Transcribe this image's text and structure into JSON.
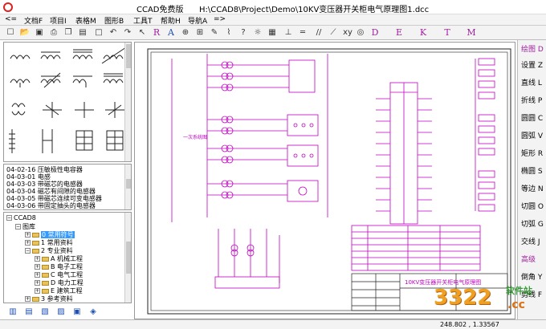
{
  "window": {
    "app_name": "CCAD免费版",
    "document_path": "H:\\CCAD8\\Project\\Demo\\10KV变压器开关柜电气原理图1.dcc"
  },
  "menu": {
    "items": [
      {
        "label": "<="
      },
      {
        "label": "文档F"
      },
      {
        "label": "项目I"
      },
      {
        "label": "表格M"
      },
      {
        "label": "图形B"
      },
      {
        "label": "工具T"
      },
      {
        "label": "帮助H"
      },
      {
        "label": "导航A"
      },
      {
        "label": "=>"
      }
    ]
  },
  "toolbar": {
    "letters": [
      {
        "label": "R"
      },
      {
        "label": "A"
      },
      {
        "label": "D"
      },
      {
        "label": "E"
      },
      {
        "label": "K"
      },
      {
        "label": "T"
      },
      {
        "label": "M"
      }
    ]
  },
  "symbol_list": {
    "items": [
      {
        "label": "04-02-16 压敏极性电容器"
      },
      {
        "label": "04-03-01 电感"
      },
      {
        "label": "04-03-03 带磁芯的电感器"
      },
      {
        "label": "04-03-04 磁芯有间隙的电感器"
      },
      {
        "label": "04-03-05 带磁芯连续可变电感器"
      },
      {
        "label": "04-03-06 带固定抽头的电感器"
      }
    ]
  },
  "tree": {
    "root": "CCAD8",
    "library": "图库",
    "items": [
      {
        "label": "0 常用符号"
      },
      {
        "label": "1 常用资料"
      },
      {
        "label": "2 专业资料"
      },
      {
        "label": "A 机械工程"
      },
      {
        "label": "B 电子工程"
      },
      {
        "label": "C 电气工程"
      },
      {
        "label": "D 电力工程"
      },
      {
        "label": "E 建筑工程"
      },
      {
        "label": "3 参考资料"
      }
    ]
  },
  "drawing": {
    "side_label": "一次系统图",
    "title_block_red": "10KV变压器开关柜电气原理图"
  },
  "right_panel": {
    "items": [
      {
        "label": "绘图 D",
        "accent": true
      },
      {
        "label": "设置 Z",
        "accent": false
      },
      {
        "label": "直线 L",
        "accent": false
      },
      {
        "label": "折线 P",
        "accent": false
      },
      {
        "label": "圆圆 C",
        "accent": false
      },
      {
        "label": "圆弧 V",
        "accent": false
      },
      {
        "label": "矩形 R",
        "accent": false
      },
      {
        "label": "椭圆 S",
        "accent": false
      },
      {
        "label": "等边 N",
        "accent": false
      },
      {
        "label": "切圆 O",
        "accent": false
      },
      {
        "label": "切弧 G",
        "accent": false
      },
      {
        "label": "交线 J",
        "accent": false
      },
      {
        "label": "高级",
        "accent": true
      },
      {
        "label": "倒角 Y",
        "accent": false
      },
      {
        "label": "剪线 F",
        "accent": false
      }
    ]
  },
  "status": {
    "coordinates": "248.802  ,  1.33567"
  },
  "watermark": {
    "number": "3322",
    "soft": "软件站",
    "cc": ".cc"
  },
  "colors": {
    "drawing_magenta": "#c000c0",
    "selection_blue": "#3399ff",
    "accent_purple": "#a020a0"
  }
}
